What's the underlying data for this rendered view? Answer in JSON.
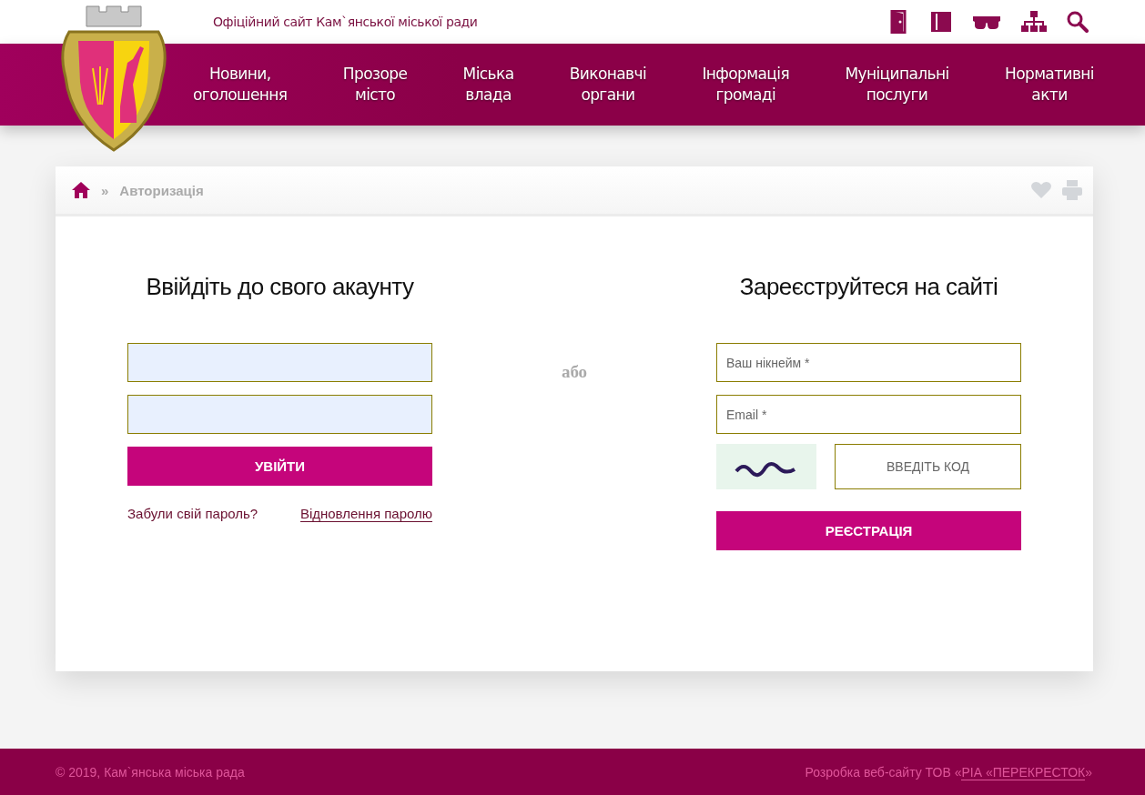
{
  "header": {
    "site_title": "Офіційний сайт Кам`янської міської ради"
  },
  "nav": {
    "items": [
      {
        "label": "Новини,\nоголошення"
      },
      {
        "label": "Прозоре\nмісто"
      },
      {
        "label": "Міська\nвлада"
      },
      {
        "label": "Виконавчі\nоргани"
      },
      {
        "label": "Інформація\nгромаді"
      },
      {
        "label": "Муніципальні\nпослуги"
      },
      {
        "label": "Нормативні\nакти"
      }
    ]
  },
  "breadcrumb": {
    "separator": "»",
    "current": "Авторизація"
  },
  "login": {
    "title": "Ввійдіть до свого акаунту",
    "button": "УВІЙТИ",
    "forgot_text": "Забули свій пароль?",
    "recover_link": "Відновлення паролю"
  },
  "divider_text": "або",
  "register": {
    "title": "Зареєструйтеся на сайті",
    "nickname_placeholder": "Ваш нікнейм *",
    "email_placeholder": "Email *",
    "captcha_placeholder": "ВВЕДІТЬ КОД",
    "button": "РЕЄСТРАЦІЯ"
  },
  "footer": {
    "copyright": "© 2019, Кам`янська міська рада",
    "credit_prefix": "Розробка веб-сайту ТОВ «",
    "credit_link": "РІА «ПЕРЕКРЕСТОК",
    "credit_suffix": "»"
  }
}
